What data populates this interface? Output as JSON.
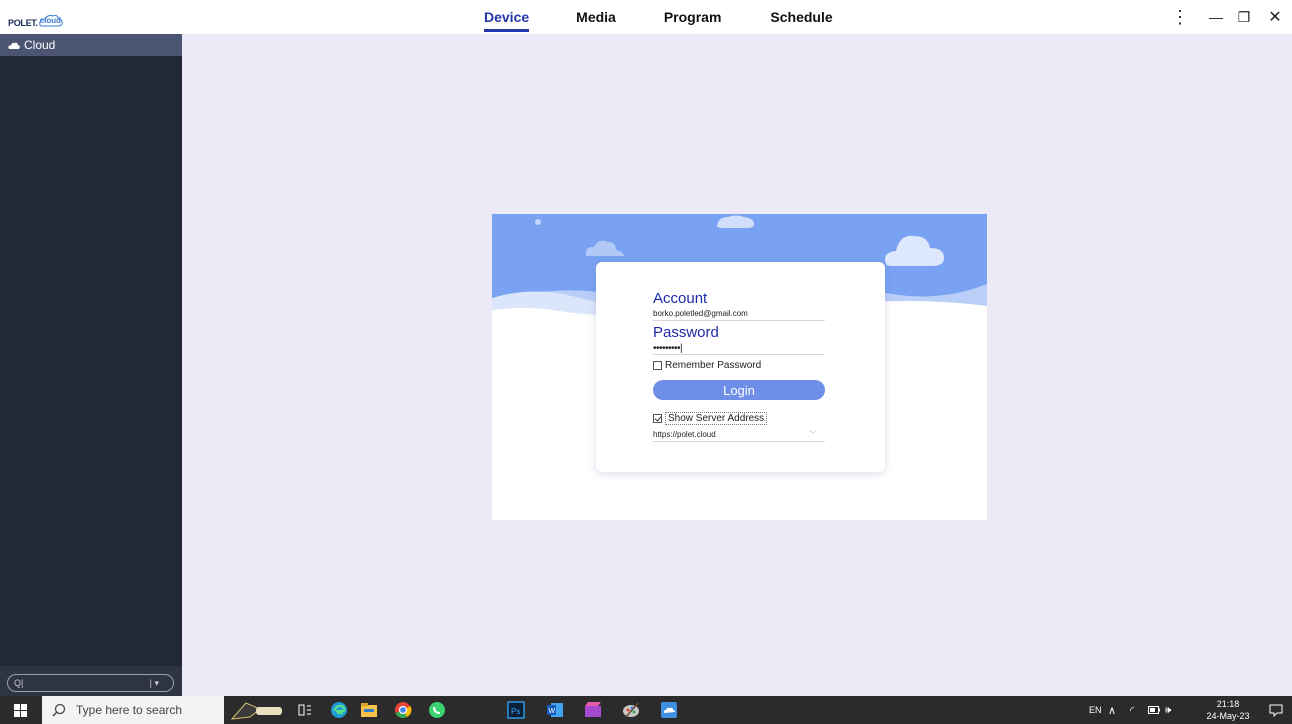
{
  "app": {
    "logo_text": "POLET.",
    "logo_cloud_text": "cloud"
  },
  "nav": {
    "tabs": [
      {
        "label": "Device",
        "active": true
      },
      {
        "label": "Media",
        "active": false
      },
      {
        "label": "Program",
        "active": false
      },
      {
        "label": "Schedule",
        "active": false
      }
    ]
  },
  "window_controls": {
    "menu": "⋮",
    "minimize": "—",
    "restore": "❐",
    "close": "✕"
  },
  "sidebar": {
    "items": [
      {
        "label": "Cloud",
        "icon": "cloud-icon"
      }
    ],
    "search": {
      "q": "Q|",
      "dropdown": "| ▾"
    }
  },
  "login": {
    "account_label": "Account",
    "account_value": "borko.poletled@gmail.com",
    "password_label": "Password",
    "password_value": "•••••••••|",
    "remember_label": "Remember Password",
    "remember_checked": false,
    "login_button": "Login",
    "show_server_label": "Show Server Address",
    "show_server_checked": true,
    "server_value": "https://polet.cloud"
  },
  "taskbar": {
    "search_placeholder": "Type here to search",
    "tray_lang": "EN",
    "time": "21:18",
    "date": "24-May-23"
  },
  "colors": {
    "accent": "#2236a8",
    "sidebar_bg": "#222936",
    "sidebar_item_bg": "#4b5571",
    "content_bg": "#ebeaf6",
    "login_button": "#6f8ee8",
    "banner_blue": "#7aa2f2"
  }
}
